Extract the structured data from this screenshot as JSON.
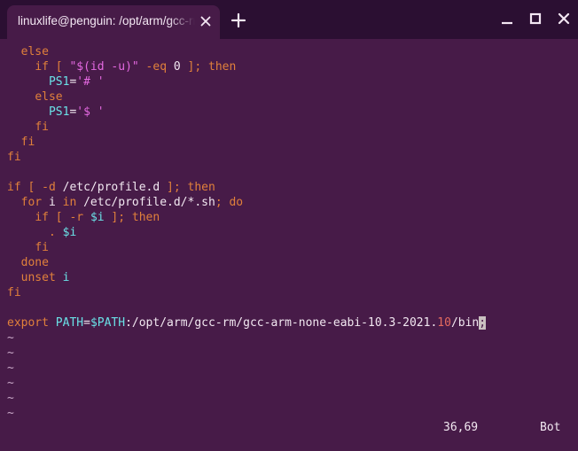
{
  "window": {
    "tab_title": "linuxlife@penguin: /opt/arm/gcc-rm",
    "new_tab_icon": "plus-icon",
    "close_tab_icon": "close-icon"
  },
  "colors": {
    "background": "#471b48",
    "titlebar": "#2b0f32",
    "keyword": "#e0803b",
    "string": "#e469e1",
    "variable": "#6ae0e6",
    "number": "#e56a5f",
    "text": "#f2e8f1"
  },
  "editor": {
    "lines": [
      [
        {
          "t": "  "
        },
        {
          "t": "else",
          "c": "kw"
        }
      ],
      [
        {
          "t": "    "
        },
        {
          "t": "if [ ",
          "c": "kw"
        },
        {
          "t": "\"$(id -u)\"",
          "c": "str"
        },
        {
          "t": " -eq ",
          "c": "kw"
        },
        {
          "t": "0"
        },
        {
          "t": " ]; then",
          "c": "kw"
        }
      ],
      [
        {
          "t": "      "
        },
        {
          "t": "PS1",
          "c": "var"
        },
        {
          "t": "="
        },
        {
          "t": "'# '",
          "c": "str"
        }
      ],
      [
        {
          "t": "    "
        },
        {
          "t": "else",
          "c": "kw"
        }
      ],
      [
        {
          "t": "      "
        },
        {
          "t": "PS1",
          "c": "var"
        },
        {
          "t": "="
        },
        {
          "t": "'$ '",
          "c": "str"
        }
      ],
      [
        {
          "t": "    "
        },
        {
          "t": "fi",
          "c": "kw"
        }
      ],
      [
        {
          "t": "  "
        },
        {
          "t": "fi",
          "c": "kw"
        }
      ],
      [
        {
          "t": "fi",
          "c": "kw"
        }
      ],
      [
        {
          "t": ""
        }
      ],
      [
        {
          "t": "if [ -d ",
          "c": "kw"
        },
        {
          "t": "/etc/profile.d"
        },
        {
          "t": " ]; then",
          "c": "kw"
        }
      ],
      [
        {
          "t": "  "
        },
        {
          "t": "for ",
          "c": "kw"
        },
        {
          "t": "i"
        },
        {
          "t": " in ",
          "c": "kw"
        },
        {
          "t": "/etc/profile.d/*.sh"
        },
        {
          "t": "; do",
          "c": "kw"
        }
      ],
      [
        {
          "t": "    "
        },
        {
          "t": "if [ -r ",
          "c": "kw"
        },
        {
          "t": "$i",
          "c": "var"
        },
        {
          "t": " ]; then",
          "c": "kw"
        }
      ],
      [
        {
          "t": "      "
        },
        {
          "t": ". ",
          "c": "kw"
        },
        {
          "t": "$i",
          "c": "var"
        }
      ],
      [
        {
          "t": "    "
        },
        {
          "t": "fi",
          "c": "kw"
        }
      ],
      [
        {
          "t": "  "
        },
        {
          "t": "done",
          "c": "kw"
        }
      ],
      [
        {
          "t": "  "
        },
        {
          "t": "unset ",
          "c": "kw"
        },
        {
          "t": "i",
          "c": "var"
        }
      ],
      [
        {
          "t": "fi",
          "c": "kw"
        }
      ],
      [
        {
          "t": ""
        }
      ],
      [
        {
          "t": "export ",
          "c": "kw"
        },
        {
          "t": "PATH",
          "c": "var"
        },
        {
          "t": "="
        },
        {
          "t": "$PATH",
          "c": "var"
        },
        {
          "t": ":/opt/arm/gcc-rm/gcc-arm-none-eabi-10.3-2021."
        },
        {
          "t": "10",
          "c": "num"
        },
        {
          "t": "/bin"
        },
        {
          "t": ";",
          "c": "cursor"
        }
      ],
      [
        {
          "t": "~",
          "c": "tilde"
        }
      ],
      [
        {
          "t": "~",
          "c": "tilde"
        }
      ],
      [
        {
          "t": "~",
          "c": "tilde"
        }
      ],
      [
        {
          "t": "~",
          "c": "tilde"
        }
      ],
      [
        {
          "t": "~",
          "c": "tilde"
        }
      ],
      [
        {
          "t": "~",
          "c": "tilde"
        }
      ]
    ]
  },
  "status_bar": {
    "position": "36,69",
    "scroll": "Bot"
  }
}
